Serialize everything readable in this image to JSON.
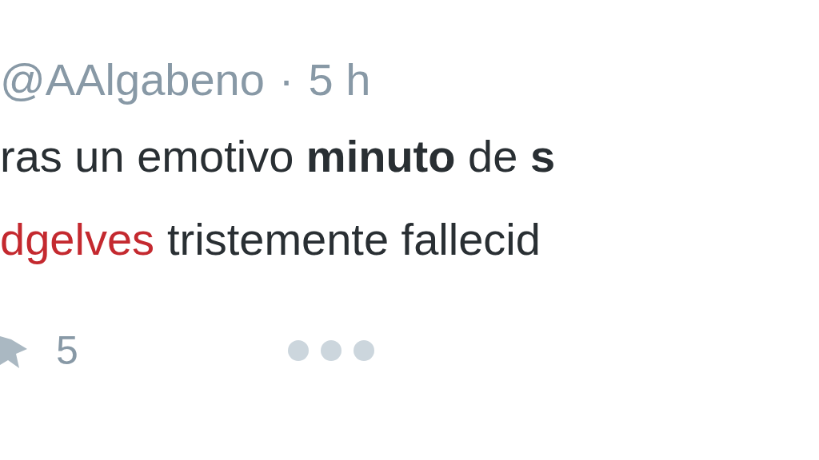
{
  "tweet": {
    "handle": "@AAlgabeno",
    "separator": "·",
    "time": "5 h",
    "text": "ras un emotivo **minuto** de **s**",
    "link": "dgelves",
    "text_after": "tristemente fallecid"
  },
  "actions": {
    "favorite_count": "5"
  }
}
